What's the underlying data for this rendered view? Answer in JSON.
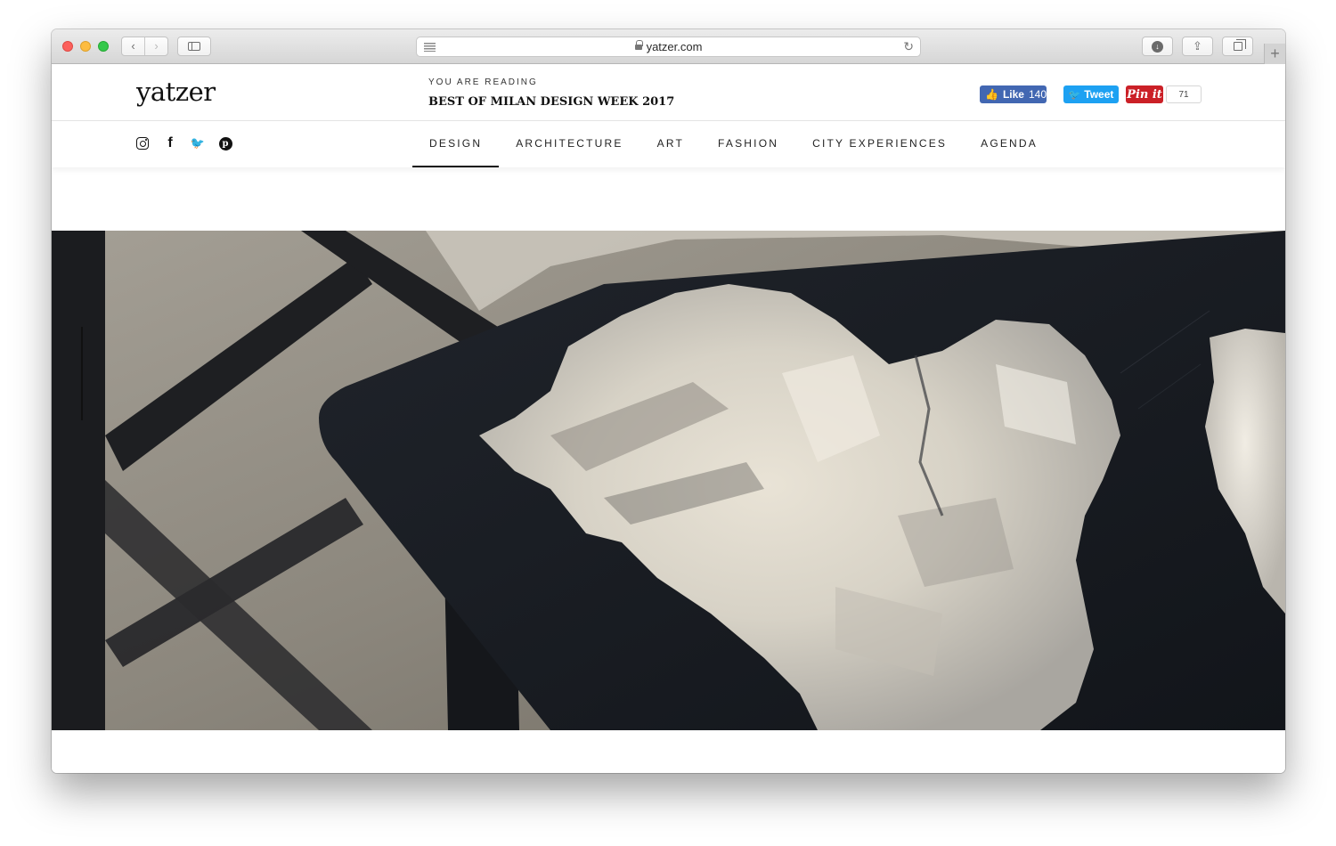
{
  "browser": {
    "url": "yatzer.com",
    "nav_back": "‹",
    "nav_forward": "›",
    "reload_glyph": "↻",
    "download_glyph": "↓",
    "share_glyph": "⇪",
    "newtab_glyph": "+",
    "traffic_colors": {
      "close": "#fc605c",
      "minimize": "#fdbc40",
      "zoom": "#34c84a"
    }
  },
  "site": {
    "logo": "yatzer",
    "reading_label": "YOU ARE READING",
    "reading_title": "BEST OF MILAN DESIGN WEEK 2017"
  },
  "share": {
    "facebook_label": "Like",
    "facebook_count": "140",
    "facebook_color": "#4267b2",
    "tweet_label": "Tweet",
    "tweet_color": "#1da1f2",
    "pin_label": "Pin it",
    "pin_color": "#cb2027",
    "pin_count": "71"
  },
  "social_icons": [
    "instagram-icon",
    "facebook-icon",
    "twitter-icon",
    "pinterest-icon"
  ],
  "nav": {
    "items": [
      {
        "label": "DESIGN",
        "active": true
      },
      {
        "label": "ARCHITECTURE",
        "active": false
      },
      {
        "label": "ART",
        "active": false
      },
      {
        "label": "FASHION",
        "active": false
      },
      {
        "label": "CITY EXPERIENCES",
        "active": false
      },
      {
        "label": "AGENDA",
        "active": false
      }
    ]
  },
  "hero": {
    "subject": "black table with white selenite crystal inlay on concrete floor"
  }
}
